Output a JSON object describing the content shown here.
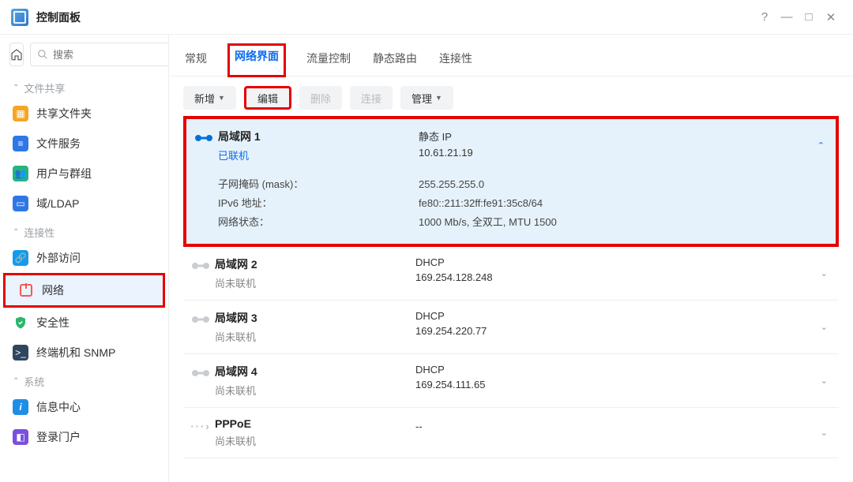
{
  "window": {
    "title": "控制面板"
  },
  "search": {
    "placeholder": "搜索"
  },
  "sidebar": {
    "sections": {
      "fileshare": "文件共享",
      "connectivity": "连接性",
      "system": "系统"
    },
    "items": {
      "shared_folder": "共享文件夹",
      "file_services": "文件服务",
      "users_groups": "用户与群组",
      "domain_ldap": "域/LDAP",
      "external_access": "外部访问",
      "network": "网络",
      "security": "安全性",
      "terminal_snmp": "终端机和 SNMP",
      "info_center": "信息中心",
      "login_portal": "登录门户"
    }
  },
  "tabs": {
    "general": "常规",
    "interfaces": "网络界面",
    "traffic": "流量控制",
    "static_route": "静态路由",
    "connectivity": "连接性"
  },
  "toolbar": {
    "add": "新增",
    "edit": "编辑",
    "delete": "删除",
    "connect": "连接",
    "manage": "管理"
  },
  "detail_labels": {
    "subnet": "子网掩码 (mask)：",
    "ipv6": "IPv6 地址：",
    "netstate": "网络状态："
  },
  "interfaces": [
    {
      "name": "局域网 1",
      "status": "已联机",
      "linked": true,
      "ipmode": "静态 IP",
      "ip": "10.61.21.19",
      "expanded": true,
      "details": {
        "subnet": "255.255.255.0",
        "ipv6": "fe80::211:32ff:fe91:35c8/64",
        "netstate": "1000 Mb/s, 全双工, MTU 1500"
      }
    },
    {
      "name": "局域网 2",
      "status": "尚未联机",
      "linked": false,
      "ipmode": "DHCP",
      "ip": "169.254.128.248",
      "expanded": false
    },
    {
      "name": "局域网 3",
      "status": "尚未联机",
      "linked": false,
      "ipmode": "DHCP",
      "ip": "169.254.220.77",
      "expanded": false
    },
    {
      "name": "局域网 4",
      "status": "尚未联机",
      "linked": false,
      "ipmode": "DHCP",
      "ip": "169.254.111.65",
      "expanded": false
    },
    {
      "name": "PPPoE",
      "status": "尚未联机",
      "linked": false,
      "ipmode": "",
      "ip": "--",
      "expanded": false,
      "pppoe": true
    }
  ]
}
